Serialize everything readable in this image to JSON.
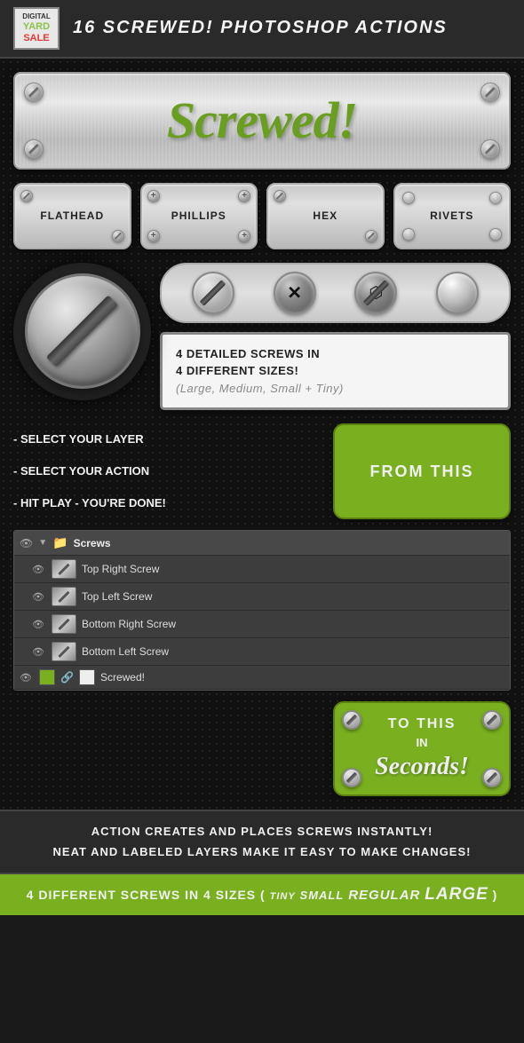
{
  "header": {
    "logo": {
      "line1": "DIGITAL",
      "line2": "YARD",
      "line3": "SALE"
    },
    "title": "16 SCREWED! PHOTOSHOP ACTIONS"
  },
  "banner": {
    "text": "Screwed!"
  },
  "screw_types": [
    {
      "label": "FLATHEAD"
    },
    {
      "label": "PHILLIPS"
    },
    {
      "label": "HEX"
    },
    {
      "label": "RIVETS"
    }
  ],
  "detail": {
    "info": {
      "line1": "4 DETAILED SCREWS IN",
      "line2": "4 DIFFERENT SIZES!",
      "line3": "(Large, Medium, Small + Tiny)"
    }
  },
  "instructions": {
    "step1": "- SELECT YOUR LAYER",
    "step2": "- SELECT YOUR ACTION",
    "step3": "- HIT PLAY - YOU'RE DONE!"
  },
  "from_this": {
    "label": "FROM THIS"
  },
  "layers": {
    "title": "Screws",
    "items": [
      {
        "name": "Top Right Screw"
      },
      {
        "name": "Top Left Screw"
      },
      {
        "name": "Bottom Right Screw"
      },
      {
        "name": "Bottom Left Screw"
      },
      {
        "name": "Screwed!"
      }
    ]
  },
  "to_this": {
    "label": "TO THIS",
    "in": "IN",
    "seconds": "Seconds!"
  },
  "footer": {
    "line1": "ACTION CREATES AND PLACES SCREWS INSTANTLY!",
    "line2": "NEAT AND LABELED LAYERS MAKE IT EASY TO MAKE CHANGES!"
  },
  "sizes": {
    "prefix": "4 DIFFERENT SCREWS",
    "inword": "IN 4 SIZES",
    "tiny": "TINY",
    "small": "SMALL",
    "regular": "REGULAR",
    "large": "LARGE"
  }
}
